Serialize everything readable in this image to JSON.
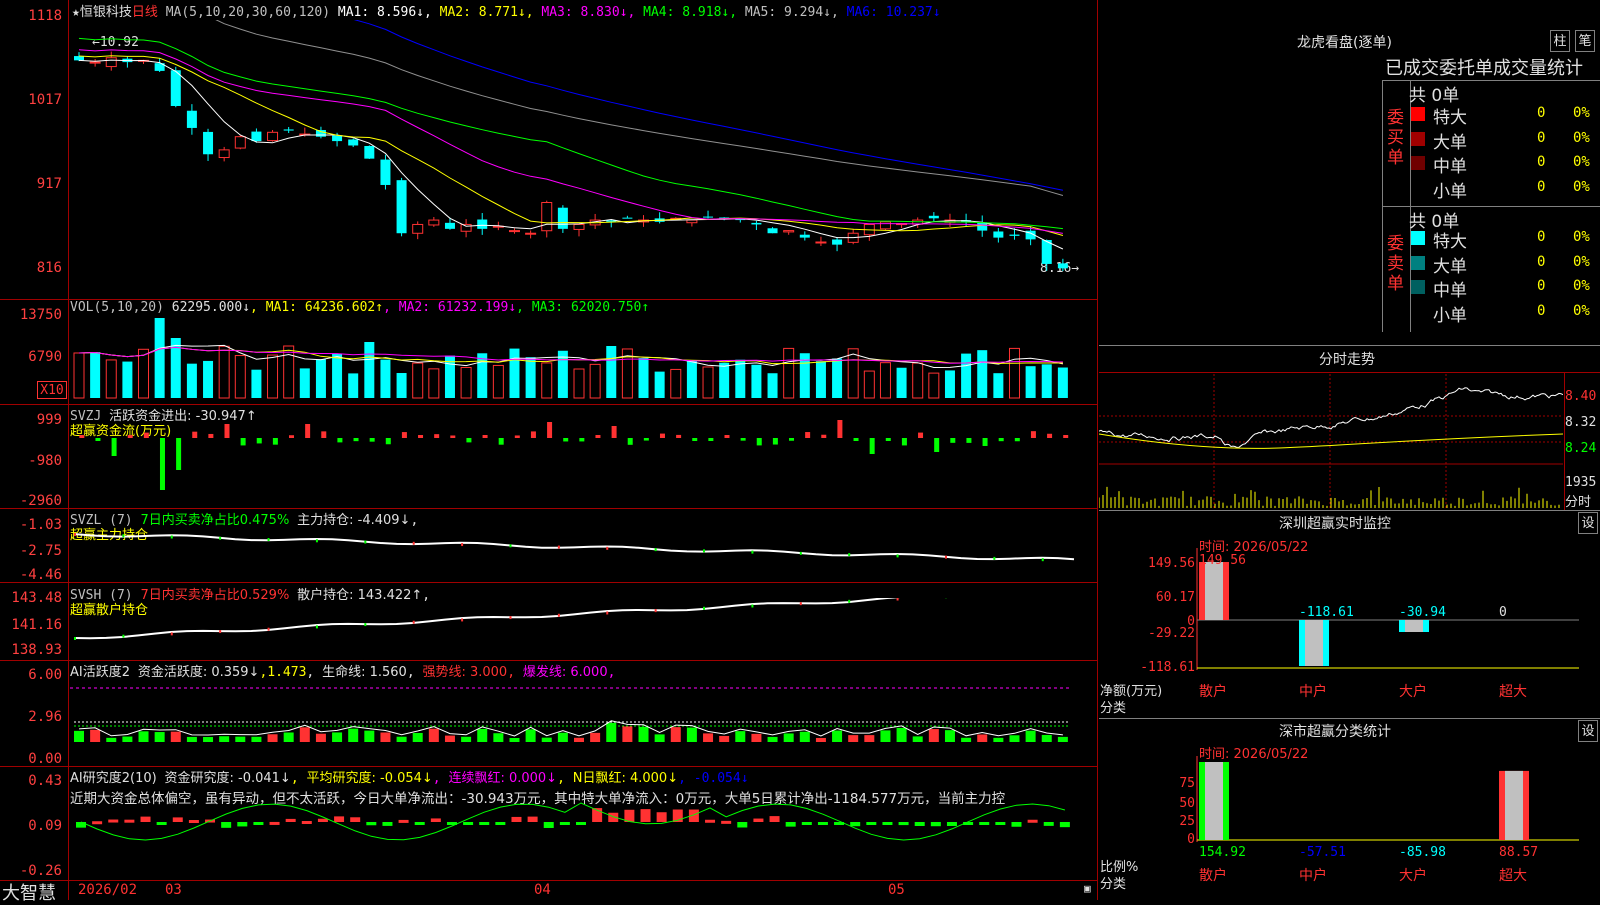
{
  "colors": {
    "up": "#ff3232",
    "down": "#00ffff",
    "vol_up": "#ff3232",
    "green": "#00ff00",
    "white": "#ffffff",
    "yellow": "#ffff00",
    "magenta": "#ff00ff",
    "blue": "#0000ff",
    "gray": "#808080",
    "grid": "#a00000"
  },
  "main_chart": {
    "star_icon": "★",
    "stock_name": "恒银科技",
    "period": "日线",
    "ma_header": "MA(5,10,20,30,60,120)",
    "ma_readouts": [
      {
        "text": "MA1: 8.596↓",
        "color": "#ffffff"
      },
      {
        "text": "MA2: 8.771↓",
        "color": "#ffff00"
      },
      {
        "text": "MA3: 8.830↓",
        "color": "#ff00ff"
      },
      {
        "text": "MA4: 8.918↓",
        "color": "#00ff00"
      },
      {
        "text": "MA5: 9.294↓",
        "color": "#c0c0c0"
      },
      {
        "text": "MA6: 10.237↓",
        "color": "#0000ff"
      }
    ],
    "y_ticks": [
      "1118",
      "1017",
      "917",
      "816"
    ],
    "high_marker": "←10.92",
    "low_marker": "8.16→"
  },
  "volume_panel": {
    "title": "VOL(5,10,20)",
    "value": "62295.000↓",
    "ma1": "MA1: 64236.602↑",
    "ma2": "MA2: 61232.199↓",
    "ma3": "MA3: 62020.750↑",
    "y_ticks": [
      "13750",
      "6790"
    ],
    "unit_badge": "X10"
  },
  "svzj_panel": {
    "title": "SVZJ",
    "line1": "活跃资金进出: -30.947↑",
    "line2": "超赢资金流(万元)",
    "y_ticks": [
      "999",
      "-980",
      "-2960"
    ]
  },
  "svzl_panel": {
    "title": "SVZL (7)",
    "ratio": "7日内买卖净占比0.475%",
    "hold": "主力持仓: -4.409↓",
    "line2": "超赢主力持仓",
    "y_ticks": [
      "-1.03",
      "-2.75",
      "-4.46"
    ]
  },
  "svsh_panel": {
    "title": "SVSH (7)",
    "ratio": "7日内买卖净占比0.529%",
    "hold": "散户持仓: 143.422↑",
    "line2": "超赢散户持仓",
    "y_ticks": [
      "143.48",
      "141.16",
      "138.93"
    ]
  },
  "ai_active_panel": {
    "title": "AI活跃度2",
    "fund": "资金活跃度: 0.359↓",
    "v2": "1.473",
    "life": "生命线: 1.560",
    "strong": "强势线: 3.000",
    "burst": "爆发线: 6.000",
    "y_ticks": [
      "6.00",
      "2.96",
      "0.00"
    ]
  },
  "ai_research_panel": {
    "title": "AI研究度2(10)",
    "research": "资金研究度: -0.041↓",
    "avg": "平均研究度: -0.054↓",
    "consec": "连续飘红: 0.000↓",
    "nday": "N日飘红: 4.000↓",
    "last": "-0.054↓",
    "comment": "近期大资金总体偏空，虽有异动，但不太活跃，今日大单净流出：-30.943万元，其中特大单净流入：0万元，大单5日累计净出-1184.577万元，当前主力控",
    "y_ticks": [
      "0.43",
      "0.09",
      "-0.26"
    ]
  },
  "bottom_bar": {
    "brand": "大智慧",
    "dates": [
      "2026/02",
      "03",
      "04",
      "05"
    ]
  },
  "dragon_tiger": {
    "title": "龙虎看盘(逐单)",
    "btn1": "柱",
    "btn2": "笔",
    "subtitle": "已成交委托单成交量统计",
    "buy_label": "委买单",
    "sell_label": "委卖单",
    "buy_total": "共 0单",
    "sell_total": "共 0单",
    "buy_rows": [
      {
        "name": "特大",
        "count": "0",
        "pct": "0%",
        "color": "#ff0000"
      },
      {
        "name": "大单",
        "count": "0",
        "pct": "0%",
        "color": "#a00000"
      },
      {
        "name": "中单",
        "count": "0",
        "pct": "0%",
        "color": "#700000"
      },
      {
        "name": "小单",
        "count": "0",
        "pct": "0%",
        "color": "#000000"
      }
    ],
    "sell_rows": [
      {
        "name": "特大",
        "count": "0",
        "pct": "0%",
        "color": "#00ffff"
      },
      {
        "name": "大单",
        "count": "0",
        "pct": "0%",
        "color": "#008080"
      },
      {
        "name": "中单",
        "count": "0",
        "pct": "0%",
        "color": "#006060"
      },
      {
        "name": "小单",
        "count": "0",
        "pct": "0%",
        "color": "#000000"
      }
    ]
  },
  "intraday": {
    "title": "分时走势",
    "price_ticks": [
      "8.40",
      "8.32",
      "8.24"
    ],
    "vol_tick": "1935",
    "vol_label": "分时"
  },
  "sz_monitor": {
    "title": "深圳超赢实时监控",
    "settings": "设",
    "time": "时间: 2026/05/22",
    "y_ticks": [
      "149.56",
      "60.17",
      "0",
      "-29.22",
      "-118.61"
    ],
    "unit_label": "净额(万元)",
    "class_label": "分类",
    "categories": [
      "散户",
      "中户",
      "大户",
      "超大"
    ],
    "values": [
      149.56,
      -118.61,
      -30.94,
      0
    ],
    "value_labels": [
      "149.56",
      "-118.61",
      "-30.94",
      "0"
    ]
  },
  "sz_classify": {
    "title": "深市超赢分类统计",
    "settings": "设",
    "time": "时间: 2026/05/22",
    "y_ticks": [
      "75",
      "50",
      "25",
      "0"
    ],
    "ratio_label": "比例%",
    "class_label": "分类",
    "categories": [
      "散户",
      "中户",
      "大户",
      "超大"
    ],
    "values": [
      154.92,
      -57.51,
      -85.98,
      88.57
    ],
    "value_labels": [
      "154.92",
      "-57.51",
      "-85.98",
      "88.57"
    ]
  }
}
